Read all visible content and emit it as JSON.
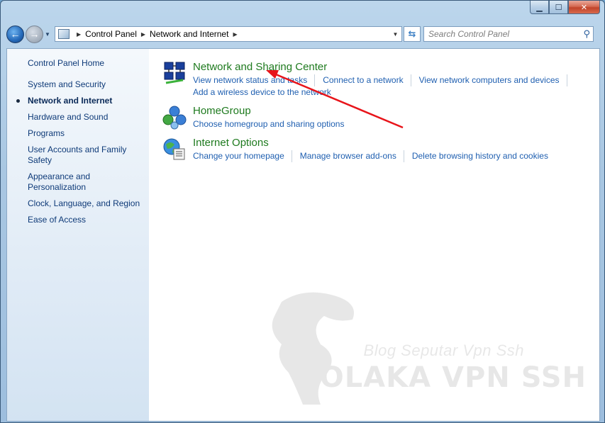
{
  "window": {
    "caption": {
      "minimize_icon": "minimize-icon",
      "maximize_icon": "maximize-icon",
      "close_icon": "close-icon"
    }
  },
  "addressbar": {
    "crumbs": [
      "Control Panel",
      "Network and Internet"
    ]
  },
  "search": {
    "placeholder": "Search Control Panel"
  },
  "sidebar": {
    "home": "Control Panel Home",
    "items": [
      {
        "label": "System and Security",
        "active": false
      },
      {
        "label": "Network and Internet",
        "active": true
      },
      {
        "label": "Hardware and Sound",
        "active": false
      },
      {
        "label": "Programs",
        "active": false
      },
      {
        "label": "User Accounts and Family Safety",
        "active": false
      },
      {
        "label": "Appearance and Personalization",
        "active": false
      },
      {
        "label": "Clock, Language, and Region",
        "active": false
      },
      {
        "label": "Ease of Access",
        "active": false
      }
    ]
  },
  "categories": [
    {
      "title": "Network and Sharing Center",
      "icon": "network-sharing-icon",
      "links": [
        "View network status and tasks",
        "Connect to a network",
        "View network computers and devices",
        "Add a wireless device to the network"
      ]
    },
    {
      "title": "HomeGroup",
      "icon": "homegroup-icon",
      "links": [
        "Choose homegroup and sharing options"
      ]
    },
    {
      "title": "Internet Options",
      "icon": "internet-options-icon",
      "links": [
        "Change your homepage",
        "Manage browser add-ons",
        "Delete browsing history and cookies"
      ]
    }
  ],
  "watermark": {
    "line1": "Blog Seputar Vpn Ssh",
    "line2": "OLAKA VPN SSH"
  },
  "colors": {
    "link": "#1f5fb0",
    "category_title": "#1e7a1e",
    "annotation_arrow": "#e8141a"
  }
}
